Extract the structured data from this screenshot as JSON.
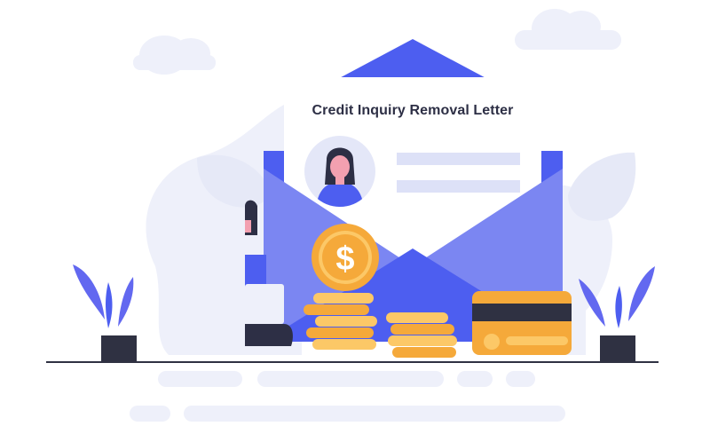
{
  "letter": {
    "title": "Credit Inquiry Removal Letter"
  },
  "illustration": {
    "coin_symbol": "$",
    "colors": {
      "envelope_blue": "#4d5ef0",
      "envelope_light": "#7b86f2",
      "coin_orange": "#f5a93a",
      "coin_light": "#fcc867",
      "soft_background": "#eef0fa",
      "plant_purple": "#6268f0",
      "pot_dark": "#2f3142"
    }
  }
}
